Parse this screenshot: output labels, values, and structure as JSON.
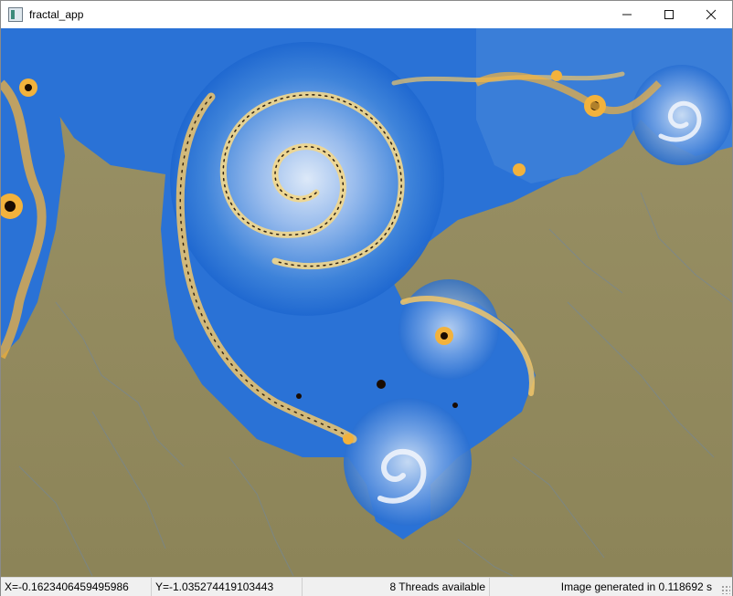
{
  "window": {
    "title": "fractal_app",
    "minimize_icon": "minimize-icon",
    "maximize_icon": "maximize-icon",
    "close_icon": "close-icon"
  },
  "fractal_view": {
    "description_icon": "fractal-image",
    "colors": {
      "background": "#8f8862",
      "blue_deep": "#1f68d0",
      "blue_light": "#c9dcf4",
      "gold": "#f0a818",
      "dark": "#1a0c02"
    }
  },
  "statusbar": {
    "x_coord": "X=-0.1623406459495986",
    "y_coord": "Y=-1.035274419103443",
    "threads": "8 Threads available",
    "render_time": "Image generated in 0.118692 s"
  }
}
